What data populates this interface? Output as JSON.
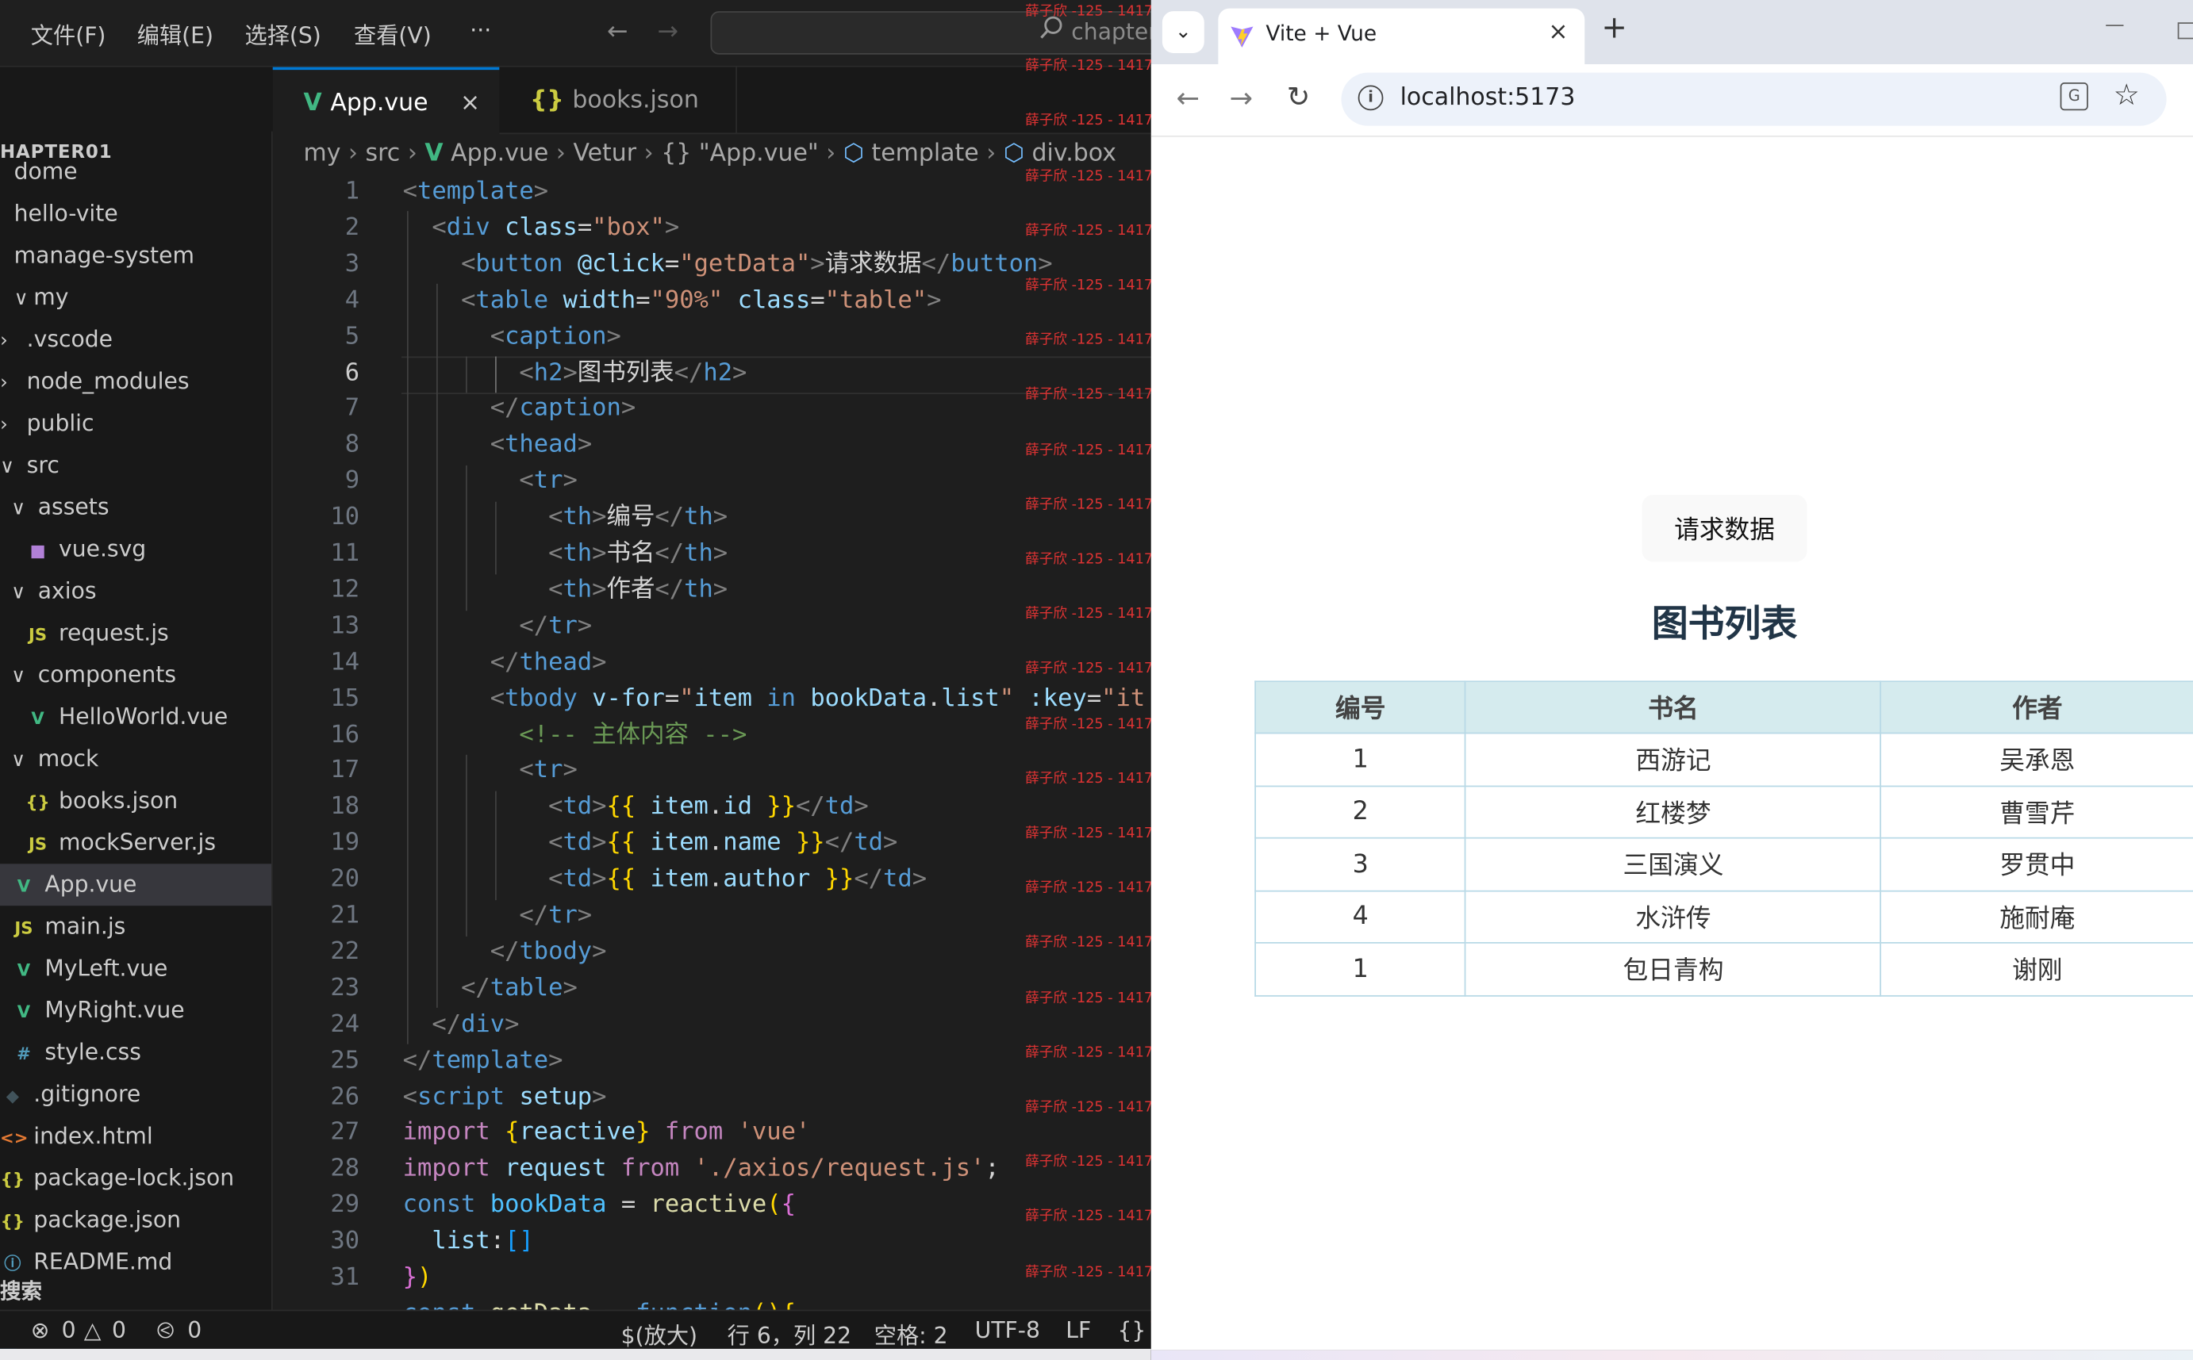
{
  "vscode": {
    "menu": [
      "文件(F)",
      "编辑(E)",
      "选择(S)",
      "查看(V)",
      "···"
    ],
    "command_center": "chapter",
    "explorer_title": "HAPTER01",
    "tree": [
      {
        "label": "dome",
        "type": "folder"
      },
      {
        "label": "hello-vite",
        "type": "folder"
      },
      {
        "label": "manage-system",
        "type": "folder"
      },
      {
        "label": "my",
        "type": "folder"
      },
      {
        "label": ".vscode",
        "type": "folder"
      },
      {
        "label": "node_modules",
        "type": "folder"
      },
      {
        "label": "public",
        "type": "folder"
      },
      {
        "label": "src",
        "type": "folder"
      },
      {
        "label": "assets",
        "type": "folder"
      },
      {
        "label": "vue.svg",
        "type": "svg"
      },
      {
        "label": "axios",
        "type": "folder"
      },
      {
        "label": "request.js",
        "type": "js"
      },
      {
        "label": "components",
        "type": "folder"
      },
      {
        "label": "HelloWorld.vue",
        "type": "vue"
      },
      {
        "label": "mock",
        "type": "folder"
      },
      {
        "label": "books.json",
        "type": "json"
      },
      {
        "label": "mockServer.js",
        "type": "js"
      },
      {
        "label": "App.vue",
        "type": "vue"
      },
      {
        "label": "main.js",
        "type": "js"
      },
      {
        "label": "MyLeft.vue",
        "type": "vue"
      },
      {
        "label": "MyRight.vue",
        "type": "vue"
      },
      {
        "label": "style.css",
        "type": "css"
      },
      {
        "label": ".gitignore",
        "type": "git"
      },
      {
        "label": "index.html",
        "type": "html"
      },
      {
        "label": "package-lock.json",
        "type": "json"
      },
      {
        "label": "package.json",
        "type": "json"
      },
      {
        "label": "README.md",
        "type": "md"
      }
    ],
    "search_section": "搜索",
    "tabs": [
      {
        "label": "App.vue",
        "active": true,
        "close": "×"
      },
      {
        "label": "books.json",
        "active": false
      }
    ],
    "breadcrumbs": [
      "my",
      "src",
      "App.vue",
      "Vetur",
      "{} \"App.vue\"",
      "template",
      "div.box"
    ],
    "line_numbers": [
      "1",
      "2",
      "3",
      "4",
      "5",
      "6",
      "7",
      "8",
      "9",
      "10",
      "11",
      "12",
      "13",
      "14",
      "15",
      "16",
      "17",
      "18",
      "19",
      "20",
      "21",
      "22",
      "23",
      "24",
      "25",
      "26",
      "27",
      "28",
      "29",
      "30",
      "31"
    ],
    "current_line": 6,
    "code_text": {
      "btn_label": "请求数据",
      "h2_text": "图书列表",
      "th1": "编号",
      "th2": "书名",
      "th3": "作者",
      "comment": "<!-- 主体内容 -->"
    },
    "watermark": "薛子欣 -125 - 1417",
    "status": {
      "errors": "0",
      "warnings": "0",
      "ports": "0",
      "zoom": "$(放大)",
      "position": "行 6，列 22",
      "spaces": "空格: 2",
      "encoding": "UTF-8",
      "eol": "LF",
      "lang": "{}"
    }
  },
  "browser": {
    "tab_title": "Vite + Vue",
    "tab_close": "×",
    "new_tab": "+",
    "url": "localhost:5173",
    "min_btn": "—",
    "page": {
      "button_label": "请求数据",
      "title": "图书列表",
      "columns": [
        "编号",
        "书名",
        "作者"
      ],
      "rows": [
        [
          "1",
          "西游记",
          "吴承恩"
        ],
        [
          "2",
          "红楼梦",
          "曹雪芹"
        ],
        [
          "3",
          "三国演义",
          "罗贯中"
        ],
        [
          "4",
          "水浒传",
          "施耐庵"
        ],
        [
          "1",
          "包日青构",
          "谢刚"
        ]
      ]
    }
  }
}
